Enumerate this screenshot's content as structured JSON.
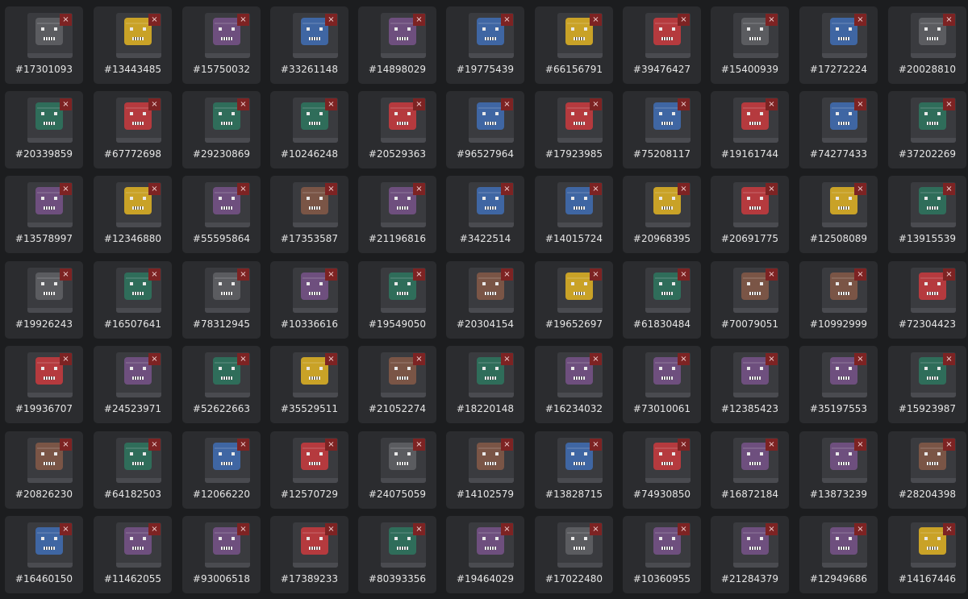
{
  "close_glyph": "×",
  "palette": {
    "gray": "#5b5c60",
    "yellow": "#c9a227",
    "purple": "#6e4f7e",
    "blue": "#3f66a3",
    "red": "#b53a3e",
    "green": "#2f6d5a",
    "brown": "#7a5546"
  },
  "rows": [
    [
      {
        "id": "#17301093",
        "color": "gray"
      },
      {
        "id": "#13443485",
        "color": "yellow"
      },
      {
        "id": "#15750032",
        "color": "purple"
      },
      {
        "id": "#33261148",
        "color": "blue"
      },
      {
        "id": "#14898029",
        "color": "purple"
      },
      {
        "id": "#19775439",
        "color": "blue"
      },
      {
        "id": "#66156791",
        "color": "yellow"
      },
      {
        "id": "#39476427",
        "color": "red"
      },
      {
        "id": "#15400939",
        "color": "gray"
      },
      {
        "id": "#17272224",
        "color": "blue"
      },
      {
        "id": "#20028810",
        "color": "gray"
      }
    ],
    [
      {
        "id": "#20339859",
        "color": "green"
      },
      {
        "id": "#67772698",
        "color": "red"
      },
      {
        "id": "#29230869",
        "color": "green"
      },
      {
        "id": "#10246248",
        "color": "green"
      },
      {
        "id": "#20529363",
        "color": "red"
      },
      {
        "id": "#96527964",
        "color": "blue"
      },
      {
        "id": "#17923985",
        "color": "red"
      },
      {
        "id": "#75208117",
        "color": "blue"
      },
      {
        "id": "#19161744",
        "color": "red"
      },
      {
        "id": "#74277433",
        "color": "blue"
      },
      {
        "id": "#37202269",
        "color": "green"
      }
    ],
    [
      {
        "id": "#13578997",
        "color": "purple"
      },
      {
        "id": "#12346880",
        "color": "yellow"
      },
      {
        "id": "#55595864",
        "color": "purple"
      },
      {
        "id": "#17353587",
        "color": "brown"
      },
      {
        "id": "#21196816",
        "color": "purple"
      },
      {
        "id": "#3422514",
        "color": "blue"
      },
      {
        "id": "#14015724",
        "color": "blue"
      },
      {
        "id": "#20968395",
        "color": "yellow"
      },
      {
        "id": "#20691775",
        "color": "red"
      },
      {
        "id": "#12508089",
        "color": "yellow"
      },
      {
        "id": "#13915539",
        "color": "green"
      }
    ],
    [
      {
        "id": "#19926243",
        "color": "gray"
      },
      {
        "id": "#16507641",
        "color": "green"
      },
      {
        "id": "#78312945",
        "color": "gray"
      },
      {
        "id": "#10336616",
        "color": "purple"
      },
      {
        "id": "#19549050",
        "color": "green"
      },
      {
        "id": "#20304154",
        "color": "brown"
      },
      {
        "id": "#19652697",
        "color": "yellow"
      },
      {
        "id": "#61830484",
        "color": "green"
      },
      {
        "id": "#70079051",
        "color": "brown"
      },
      {
        "id": "#10992999",
        "color": "brown"
      },
      {
        "id": "#72304423",
        "color": "red"
      }
    ],
    [
      {
        "id": "#19936707",
        "color": "red"
      },
      {
        "id": "#24523971",
        "color": "purple"
      },
      {
        "id": "#52622663",
        "color": "green"
      },
      {
        "id": "#35529511",
        "color": "yellow"
      },
      {
        "id": "#21052274",
        "color": "brown"
      },
      {
        "id": "#18220148",
        "color": "green"
      },
      {
        "id": "#16234032",
        "color": "purple"
      },
      {
        "id": "#73010061",
        "color": "purple"
      },
      {
        "id": "#12385423",
        "color": "purple"
      },
      {
        "id": "#35197553",
        "color": "purple"
      },
      {
        "id": "#15923987",
        "color": "green"
      }
    ],
    [
      {
        "id": "#20826230",
        "color": "brown"
      },
      {
        "id": "#64182503",
        "color": "green"
      },
      {
        "id": "#12066220",
        "color": "blue"
      },
      {
        "id": "#12570729",
        "color": "red"
      },
      {
        "id": "#24075059",
        "color": "gray"
      },
      {
        "id": "#14102579",
        "color": "brown"
      },
      {
        "id": "#13828715",
        "color": "blue"
      },
      {
        "id": "#74930850",
        "color": "red"
      },
      {
        "id": "#16872184",
        "color": "purple"
      },
      {
        "id": "#13873239",
        "color": "purple"
      },
      {
        "id": "#28204398",
        "color": "brown"
      }
    ],
    [
      {
        "id": "#16460150",
        "color": "blue"
      },
      {
        "id": "#11462055",
        "color": "purple"
      },
      {
        "id": "#93006518",
        "color": "purple"
      },
      {
        "id": "#17389233",
        "color": "red"
      },
      {
        "id": "#80393356",
        "color": "green"
      },
      {
        "id": "#19464029",
        "color": "purple"
      },
      {
        "id": "#17022480",
        "color": "gray"
      },
      {
        "id": "#10360955",
        "color": "purple"
      },
      {
        "id": "#21284379",
        "color": "purple"
      },
      {
        "id": "#12949686",
        "color": "purple"
      },
      {
        "id": "#14167446",
        "color": "yellow"
      }
    ]
  ]
}
